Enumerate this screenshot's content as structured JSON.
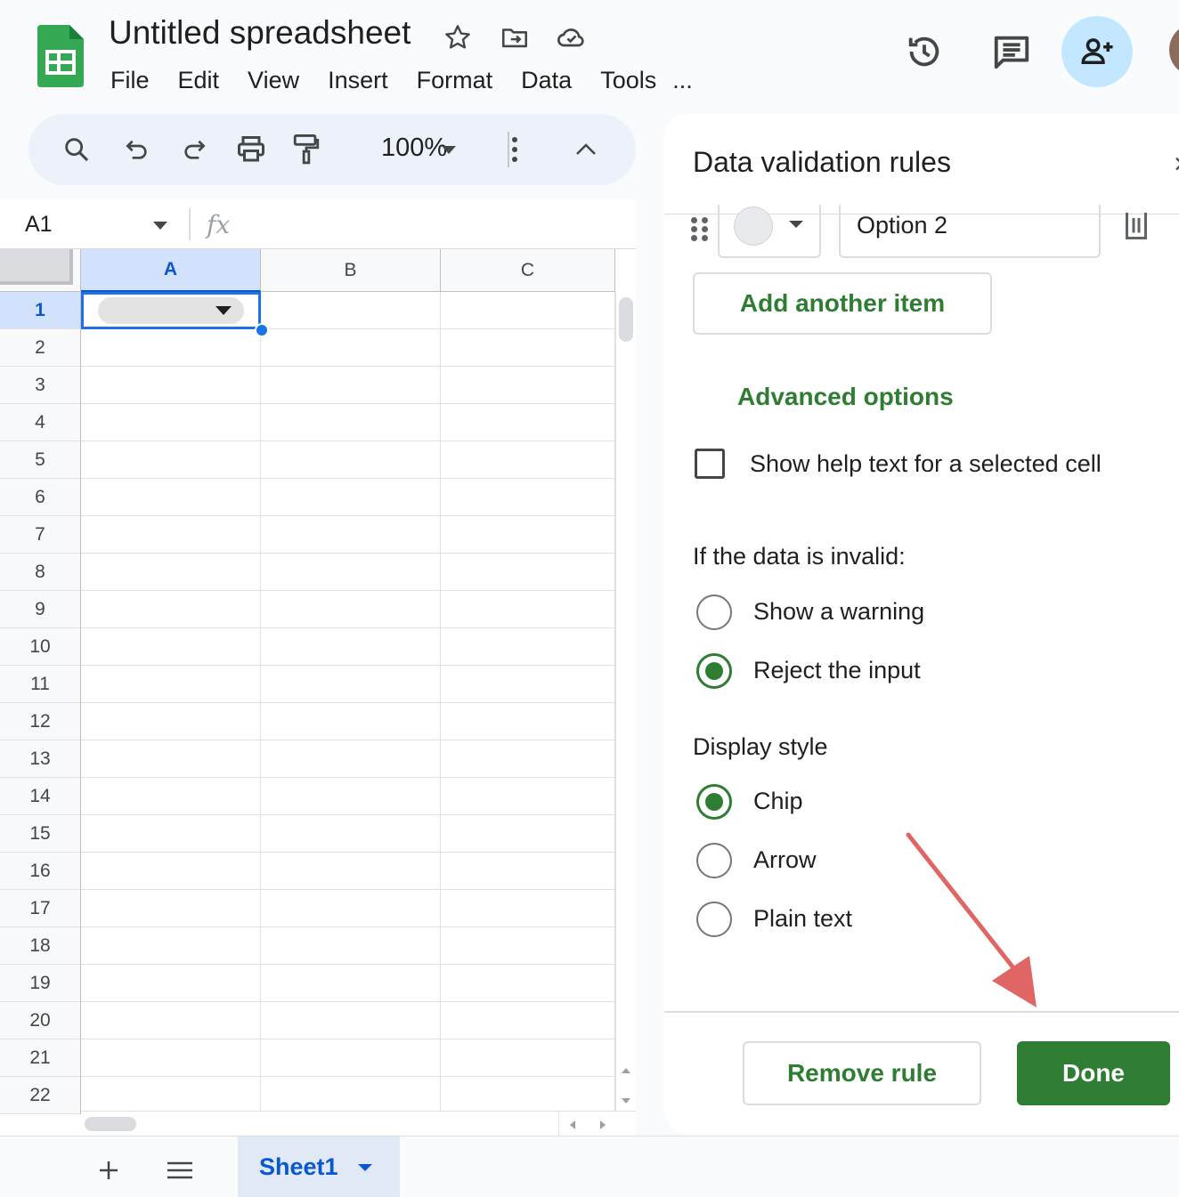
{
  "header": {
    "title": "Untitled spreadsheet",
    "menus": [
      "File",
      "Edit",
      "View",
      "Insert",
      "Format",
      "Data",
      "Tools",
      "..."
    ]
  },
  "toolbar": {
    "zoom": "100%"
  },
  "formula_bar": {
    "cell_ref": "A1",
    "fx": "fx"
  },
  "grid": {
    "columns": [
      "A",
      "B",
      "C"
    ],
    "rows": [
      "1",
      "2",
      "3",
      "4",
      "5",
      "6",
      "7",
      "8",
      "9",
      "10",
      "11",
      "12",
      "13",
      "14",
      "15",
      "16",
      "17",
      "18",
      "19",
      "20",
      "21",
      "22"
    ],
    "selected_cell": "A1"
  },
  "panel": {
    "title": "Data validation rules",
    "close": "×",
    "option_value": "Option 2",
    "add_item": "Add another item",
    "advanced_options": "Advanced options",
    "help_text_label": "Show help text for a selected cell",
    "invalid_title": "If the data is invalid:",
    "invalid_options": [
      {
        "label": "Show a warning",
        "checked": false
      },
      {
        "label": "Reject the input",
        "checked": true
      }
    ],
    "display_title": "Display style",
    "display_options": [
      {
        "label": "Chip",
        "checked": true
      },
      {
        "label": "Arrow",
        "checked": false
      },
      {
        "label": "Plain text",
        "checked": false
      }
    ],
    "remove_rule": "Remove rule",
    "done": "Done"
  },
  "bottom": {
    "sheet_tab": "Sheet1"
  },
  "colors": {
    "accent_green": "#2e7d32",
    "selection_blue": "#1a73e8",
    "annotation_red": "#e06666"
  }
}
